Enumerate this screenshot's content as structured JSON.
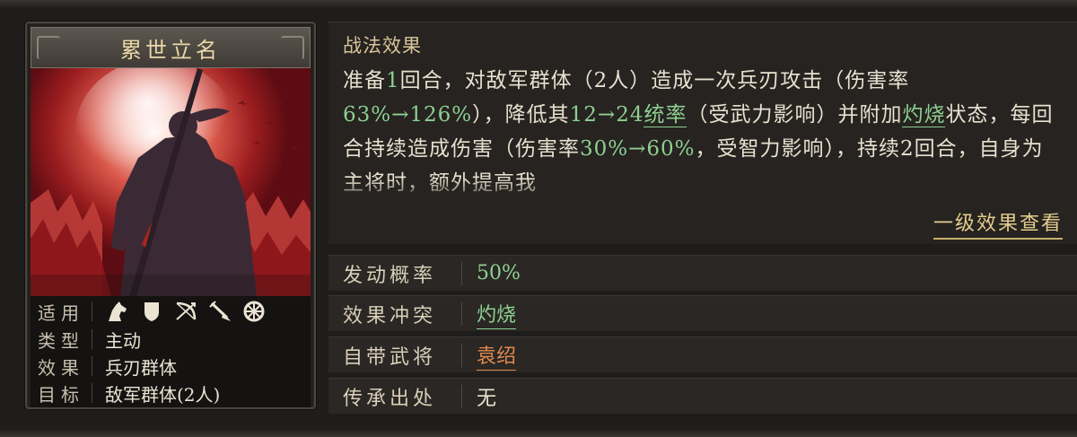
{
  "card": {
    "title": "累世立名",
    "attributes": [
      {
        "label": "适用",
        "icons": [
          "cavalry-icon",
          "shield-icon",
          "bow-icon",
          "spear-icon",
          "siege-icon"
        ]
      },
      {
        "label": "类型",
        "value": "主动"
      },
      {
        "label": "效果",
        "value": "兵刃群体"
      },
      {
        "label": "目标",
        "value": "敌军群体(2人)"
      }
    ]
  },
  "effect": {
    "title": "战法效果",
    "text_segments": [
      {
        "t": "准备"
      },
      {
        "t": "1",
        "c": "g"
      },
      {
        "t": "回合，对敌军群体（2人）造成一次兵刃攻击（伤害率"
      },
      {
        "t": "63%→126%",
        "c": "g"
      },
      {
        "t": "），降低其"
      },
      {
        "t": "12→24",
        "c": "g"
      },
      {
        "t": "统率",
        "c": "gu"
      },
      {
        "t": "（受武力影响）并附加"
      },
      {
        "t": "灼烧",
        "c": "gu"
      },
      {
        "t": "状态，每回合持续造成伤害（伤害率"
      },
      {
        "t": "30%→60%",
        "c": "g"
      },
      {
        "t": "，受智力影响），持续2回合，自身为主将时，额外提高我"
      }
    ],
    "view_link": "一级效果查看"
  },
  "properties": [
    {
      "label": "发动概率",
      "value": "50%",
      "style": "green"
    },
    {
      "label": "效果冲突",
      "value": "灼烧",
      "style": "green-u"
    },
    {
      "label": "自带武将",
      "value": "袁绍",
      "style": "orange-u"
    },
    {
      "label": "传承出处",
      "value": "无",
      "style": "white"
    }
  ],
  "colors": {
    "highlight_green": "#8ecf91",
    "highlight_orange": "#e0894e",
    "gold": "#e3cd8c"
  }
}
